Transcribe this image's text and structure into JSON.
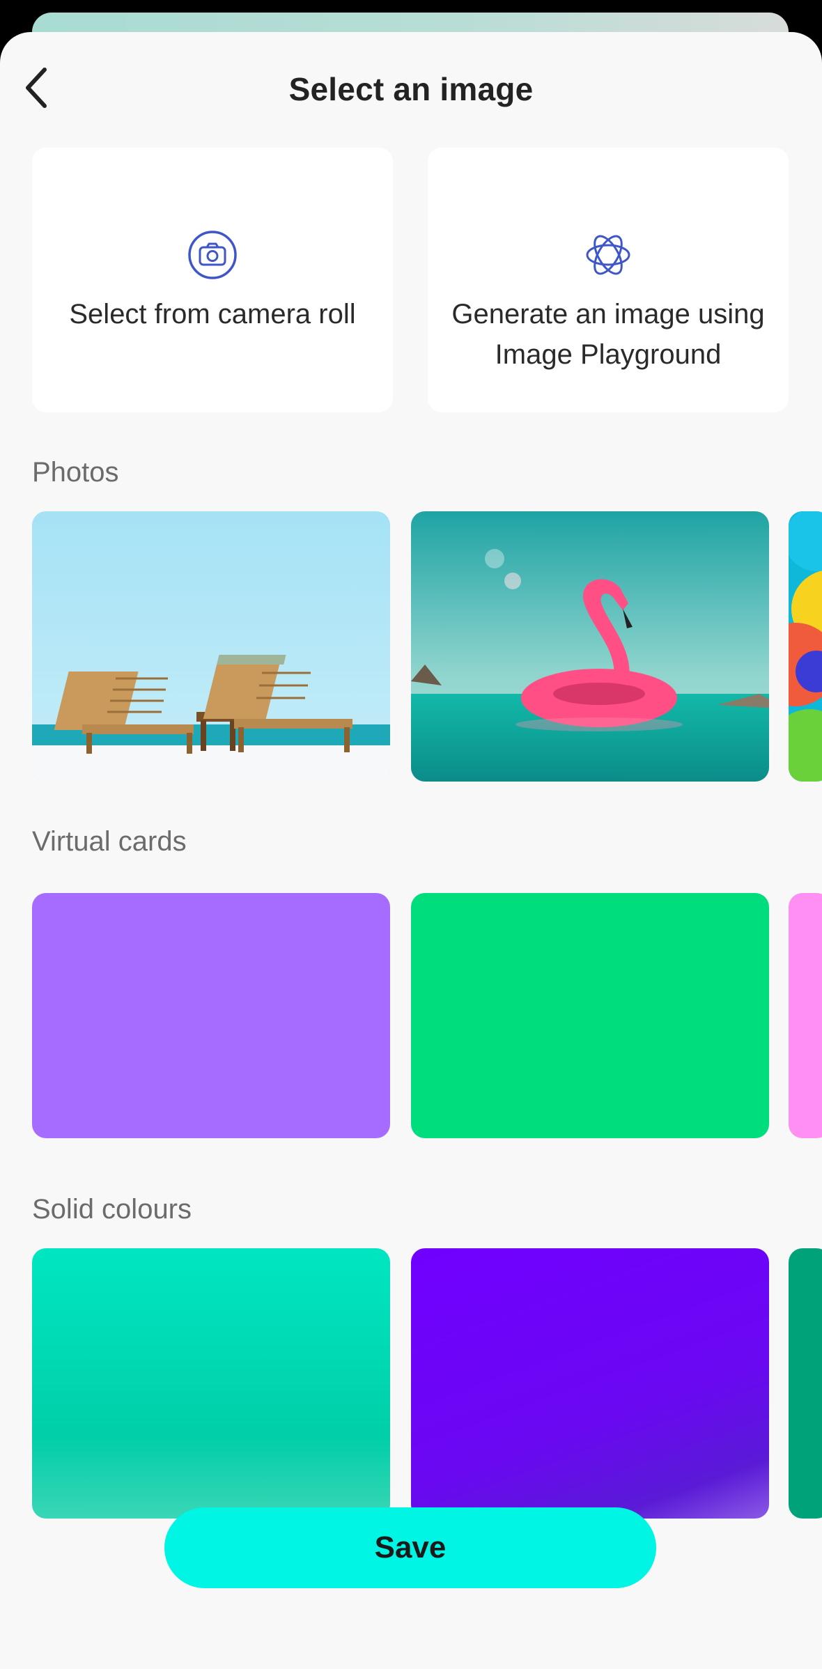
{
  "header": {
    "title": "Select an image"
  },
  "options": [
    {
      "label": "Select from camera roll",
      "icon": "camera-icon"
    },
    {
      "label": "Generate an image using Image Playground",
      "icon": "image-playground-icon"
    }
  ],
  "sections": {
    "photos": {
      "label": "Photos",
      "items": [
        "beach-loungers",
        "pink-flamingo-float",
        "colorful-balloons"
      ]
    },
    "virtual_cards": {
      "label": "Virtual cards",
      "colors": [
        "#a56cff",
        "#00dd7d",
        "#ff8ff2"
      ]
    },
    "solid_colours": {
      "label": "Solid colours",
      "colors": [
        "#00d9b4",
        "#7000ff",
        "#00a27a"
      ]
    }
  },
  "footer": {
    "save_label": "Save"
  },
  "colors": {
    "accent": "#00f5e4",
    "icon": "#3f56c8",
    "background": "#f8f8f8"
  }
}
